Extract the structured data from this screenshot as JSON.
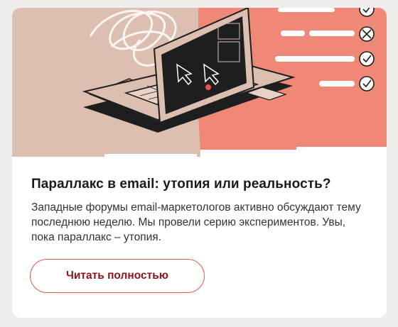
{
  "card": {
    "title": "Параллакс в email: утопия или реальность?",
    "description": "Западные форумы email-маркетологов активно обсуждают тему последнюю неделю. Мы провели серию экспериментов. Увы, пока параллакс – утопия.",
    "button_label": "Читать полностью"
  },
  "illustration": {
    "icons": [
      "laptop-icon",
      "cursor-arrow-icon",
      "checkbox-x-icon",
      "checkbox-check-icon",
      "coil-icon"
    ],
    "colors": {
      "beige": "#dcbfb0",
      "coral": "#f08878",
      "dark": "#1e1e1e",
      "white": "#ffffff"
    }
  }
}
